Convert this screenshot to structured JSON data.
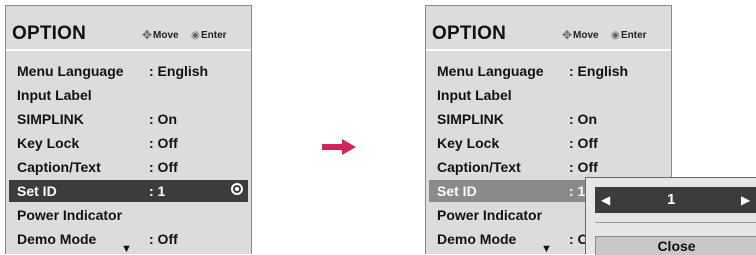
{
  "menu": {
    "title": "OPTION",
    "hints": {
      "move_icon": "move-icon",
      "move_label": "Move",
      "enter_icon": "enter-icon",
      "enter_label": "Enter"
    },
    "items": [
      {
        "label": "Menu Language",
        "value": ": English"
      },
      {
        "label": "Input Label",
        "value": ""
      },
      {
        "label": "SIMPLINK",
        "value": ": On"
      },
      {
        "label": "Key Lock",
        "value": ": Off"
      },
      {
        "label": "Caption/Text",
        "value": ": Off"
      },
      {
        "label": "Set ID",
        "value": ": 1"
      },
      {
        "label": "Power Indicator",
        "value": ""
      },
      {
        "label": "Demo Mode",
        "value": ": Off"
      }
    ],
    "selected_index": 5
  },
  "right_menu": {
    "items_values": [
      ": English",
      "",
      ": On",
      ": Off",
      ": Off",
      ": 1",
      "",
      ": Off"
    ]
  },
  "popup": {
    "value": "1",
    "close_label": "Close"
  },
  "colors": {
    "panel_bg": "#dcdcdc",
    "highlight_bg": "#3c3c3c",
    "arrow": "#d0245c"
  }
}
